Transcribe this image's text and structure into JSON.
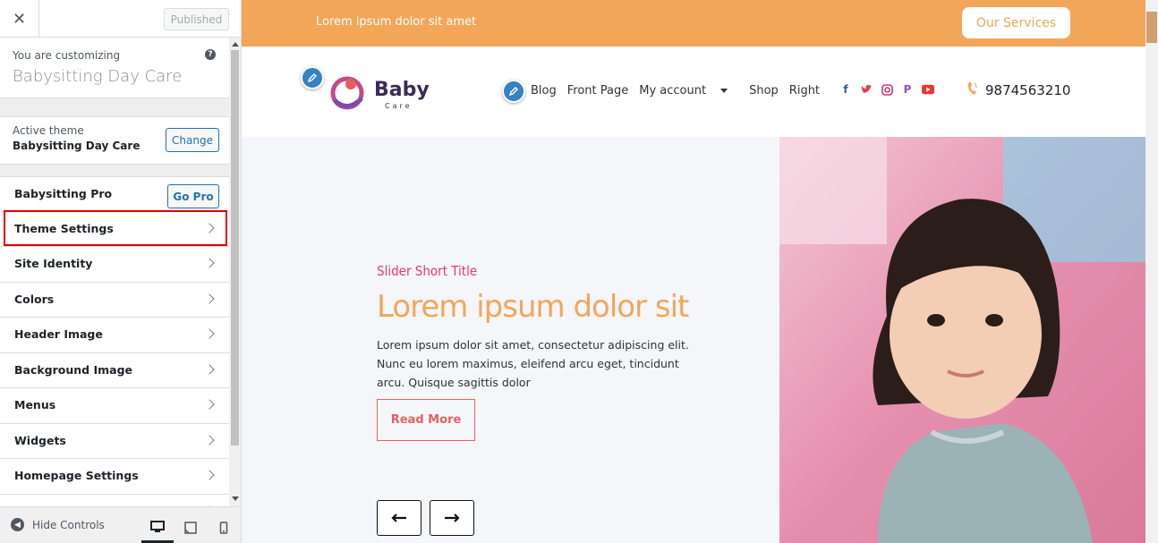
{
  "sidebar": {
    "close_label": "✕",
    "publish_label": "Published",
    "customizing_label": "You are customizing",
    "site_title": "Babysitting Day Care",
    "help_label": "?",
    "active_theme_label": "Active theme",
    "active_theme_name": "Babysitting Day Care",
    "change_label": "Change",
    "pro_label": "Babysitting Pro",
    "gopro_label": "Go Pro",
    "items": [
      {
        "label": "Theme Settings"
      },
      {
        "label": "Site Identity"
      },
      {
        "label": "Colors"
      },
      {
        "label": "Header Image"
      },
      {
        "label": "Background Image"
      },
      {
        "label": "Menus"
      },
      {
        "label": "Widgets"
      },
      {
        "label": "Homepage Settings"
      }
    ],
    "hide_controls_label": "Hide Controls"
  },
  "preview": {
    "topbar_text": "Lorem ipsum dolor sit amet",
    "services_label": "Our Services",
    "logo_word": "Baby",
    "logo_sub": "Care",
    "nav": [
      "Blog",
      "Front Page",
      "My account",
      "Shop",
      "Right"
    ],
    "phone": "9874563210",
    "slide": {
      "subtitle": "Slider Short Title",
      "title": "Lorem ipsum dolor sit",
      "text": "Lorem ipsum dolor sit amet, consectetur adipiscing elit. Nunc eu lorem maximus, eleifend arcu eget, tincidunt arcu. Quisque sagittis dolor",
      "button_label": "Read More"
    }
  },
  "colors": {
    "accent_orange": "#f2a65a",
    "accent_pink": "#e8377a",
    "button_red": "#e06464",
    "wp_blue": "#2271b1",
    "highlight_red": "#e00000"
  },
  "icons": {
    "social": [
      "facebook-icon",
      "twitter-icon",
      "instagram-icon",
      "pinterest-icon",
      "youtube-icon"
    ]
  }
}
